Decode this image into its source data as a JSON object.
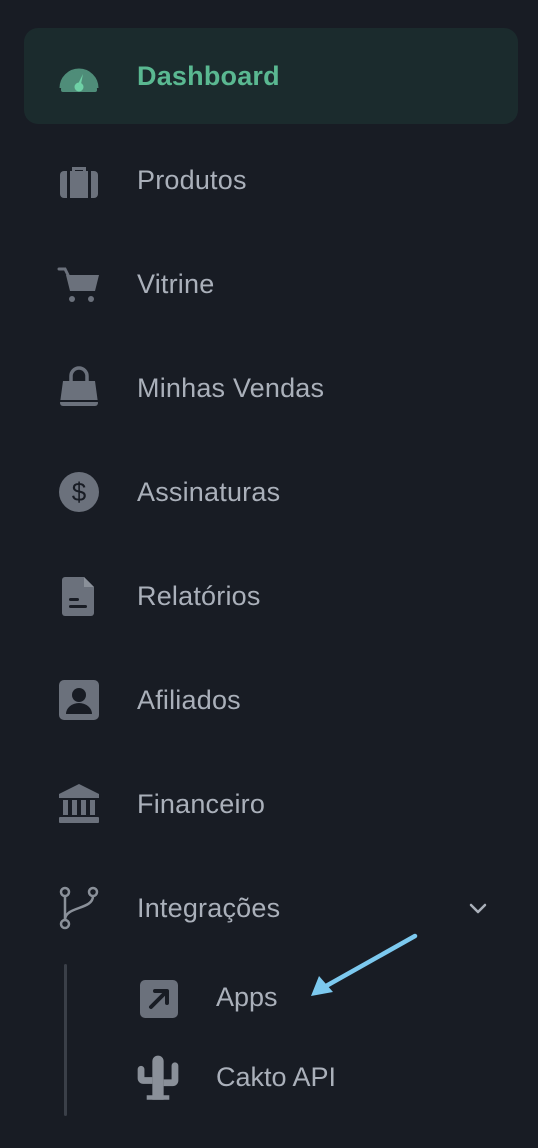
{
  "nav": {
    "items": [
      {
        "label": "Dashboard",
        "icon": "gauge-icon",
        "active": true
      },
      {
        "label": "Produtos",
        "icon": "briefcase-icon"
      },
      {
        "label": "Vitrine",
        "icon": "cart-icon"
      },
      {
        "label": "Minhas Vendas",
        "icon": "shopping-bag-icon"
      },
      {
        "label": "Assinaturas",
        "icon": "dollar-circle-icon"
      },
      {
        "label": "Relatórios",
        "icon": "document-icon"
      },
      {
        "label": "Afiliados",
        "icon": "user-badge-icon"
      },
      {
        "label": "Financeiro",
        "icon": "bank-icon"
      },
      {
        "label": "Integrações",
        "icon": "git-branch-icon",
        "expanded": true
      }
    ],
    "sub_items": [
      {
        "label": "Apps",
        "icon": "external-arrow-icon"
      },
      {
        "label": "Cakto API",
        "icon": "cactus-icon"
      }
    ]
  },
  "colors": {
    "background": "#181c24",
    "active_background": "#1b2b2d",
    "active_text": "#5ab891",
    "text": "#aab0ba",
    "icon": "#6b717c",
    "annotation_arrow": "#7cc9ef"
  }
}
